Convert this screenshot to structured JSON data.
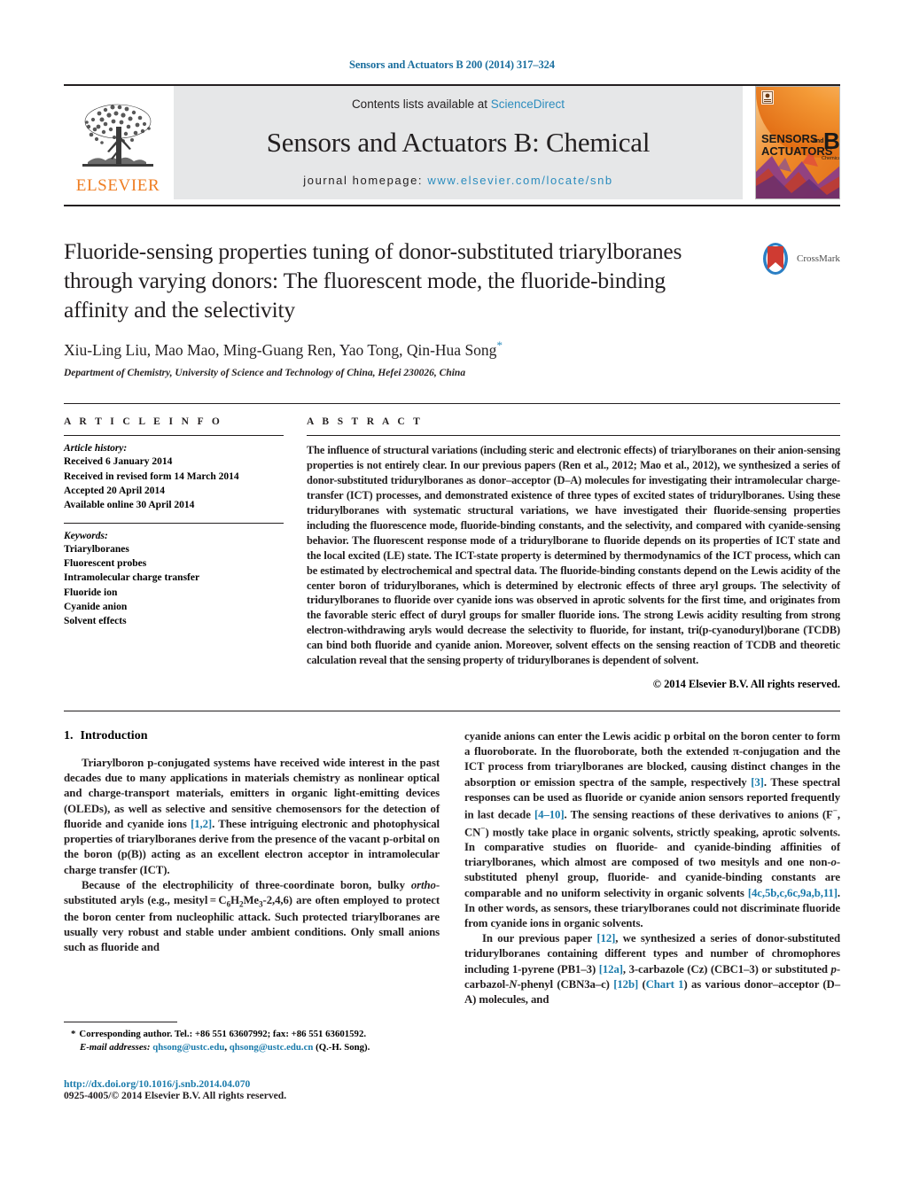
{
  "running_head": "Sensors and Actuators B 200 (2014) 317–324",
  "masthead": {
    "publisher_name": "ELSEVIER",
    "contents_prefix": "Contents lists available at ",
    "contents_link": "ScienceDirect",
    "journal_title": "Sensors and Actuators B: Chemical",
    "homepage_prefix": "journal homepage: ",
    "homepage_url": "www.elsevier.com/locate/snb",
    "cover": {
      "line1": "SENSORS",
      "line1_small": "and",
      "line2": "ACTUATORS",
      "letter": "B",
      "letter_sub": "Chemical"
    }
  },
  "article": {
    "title": "Fluoride-sensing properties tuning of donor-substituted triarylboranes through varying donors: The fluorescent mode, the fluoride-binding affinity and the selectivity",
    "authors": "Xiu-Ling Liu, Mao Mao, Ming-Guang Ren, Yao Tong, Qin-Hua Song",
    "author_star": "*",
    "affiliation": "Department of Chemistry, University of Science and Technology of China, Hefei 230026, China",
    "crossmark_label": "CrossMark"
  },
  "article_info": {
    "heading": "A R T I C L E   I N F O",
    "history_label": "Article history:",
    "history": [
      "Received 6 January 2014",
      "Received in revised form 14 March 2014",
      "Accepted 20 April 2014",
      "Available online 30 April 2014"
    ],
    "keywords_label": "Keywords:",
    "keywords": [
      "Triarylboranes",
      "Fluorescent probes",
      "Intramolecular charge transfer",
      "Fluoride ion",
      "Cyanide anion",
      "Solvent effects"
    ]
  },
  "abstract": {
    "heading": "A B S T R A C T",
    "text": "The influence of structural variations (including steric and electronic effects) of triarylboranes on their anion-sensing properties is not entirely clear. In our previous papers (Ren et al., 2012; Mao et al., 2012), we synthesized a series of donor-substituted tridurylboranes as donor–acceptor (D–A) molecules for investigating their intramolecular charge-transfer (ICT) processes, and demonstrated existence of three types of excited states of tridurylboranes. Using these tridurylboranes with systematic structural variations, we have investigated their fluoride-sensing properties including the fluorescence mode, fluoride-binding constants, and the selectivity, and compared with cyanide-sensing behavior. The fluorescent response mode of a tridurylborane to fluoride depends on its properties of ICT state and the local excited (LE) state. The ICT-state property is determined by thermodynamics of the ICT process, which can be estimated by electrochemical and spectral data. The fluoride-binding constants depend on the Lewis acidity of the center boron of tridurylboranes, which is determined by electronic effects of three aryl groups. The selectivity of tridurylboranes to fluoride over cyanide ions was observed in aprotic solvents for the first time, and originates from the favorable steric effect of duryl groups for smaller fluoride ions. The strong Lewis acidity resulting from strong electron-withdrawing aryls would decrease the selectivity to fluoride, for instant, tri(p-cyanoduryl)borane (TCDB) can bind both fluoride and cyanide anion. Moreover, solvent effects on the sensing reaction of TCDB and theoretic calculation reveal that the sensing property of tridurylboranes is dependent of solvent.",
    "copyright": "© 2014 Elsevier B.V. All rights reserved."
  },
  "introduction": {
    "number": "1.",
    "heading": "Introduction"
  },
  "footnote": {
    "star": "*",
    "corresponding": "Corresponding author. Tel.: +86 551 63607992; fax: +86 551 63601592.",
    "email_label": "E-mail addresses:",
    "email1": "qhsong@ustc.edu",
    "email2": "qhsong@ustc.edu.cn",
    "email_suffix": "(Q.-H. Song)."
  },
  "publication": {
    "doi": "http://dx.doi.org/10.1016/j.snb.2014.04.070",
    "issn_line": "0925-4005/© 2014 Elsevier B.V. All rights reserved."
  },
  "colors": {
    "link_blue": "#1a7bab",
    "elsevier_orange": "#ef7d22",
    "masthead_grey": "#e6e7e8",
    "crossmark_red": "#cf3b32",
    "crossmark_blue": "#2b7fc4"
  }
}
